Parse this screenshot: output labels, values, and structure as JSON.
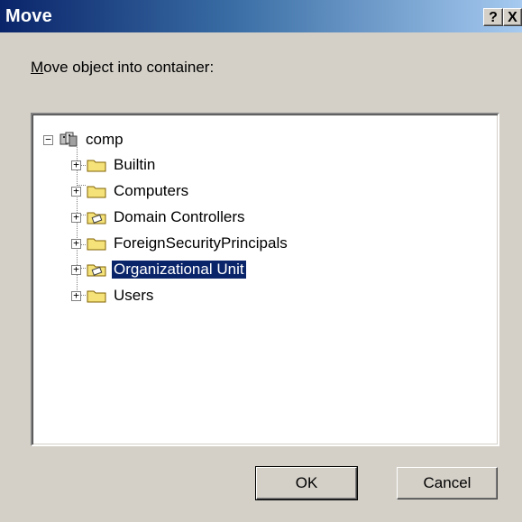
{
  "window": {
    "title": "Move",
    "help_label": "?",
    "close_label": "X"
  },
  "prompt": {
    "accel": "M",
    "rest": "ove object into container:"
  },
  "tree": {
    "root": {
      "label": "comp",
      "expander": "−",
      "icon": "domain-icon"
    },
    "children": [
      {
        "label": "Builtin",
        "expander": "+",
        "icon": "folder-icon"
      },
      {
        "label": "Computers",
        "expander": "+",
        "icon": "folder-icon"
      },
      {
        "label": "Domain Controllers",
        "expander": "+",
        "icon": "ou-folder-icon"
      },
      {
        "label": "ForeignSecurityPrincipals",
        "expander": "+",
        "icon": "folder-icon"
      },
      {
        "label": "Organizational Unit",
        "expander": "+",
        "icon": "ou-folder-icon",
        "selected": true
      },
      {
        "label": "Users",
        "expander": "+",
        "icon": "folder-icon"
      }
    ]
  },
  "buttons": {
    "ok": "OK",
    "cancel": "Cancel"
  },
  "colors": {
    "titlebar_start": "#0a246a",
    "titlebar_end": "#a6caf0",
    "selection": "#0a246a",
    "dialog_bg": "#d4d0c8",
    "folder": "#f5e37a"
  }
}
